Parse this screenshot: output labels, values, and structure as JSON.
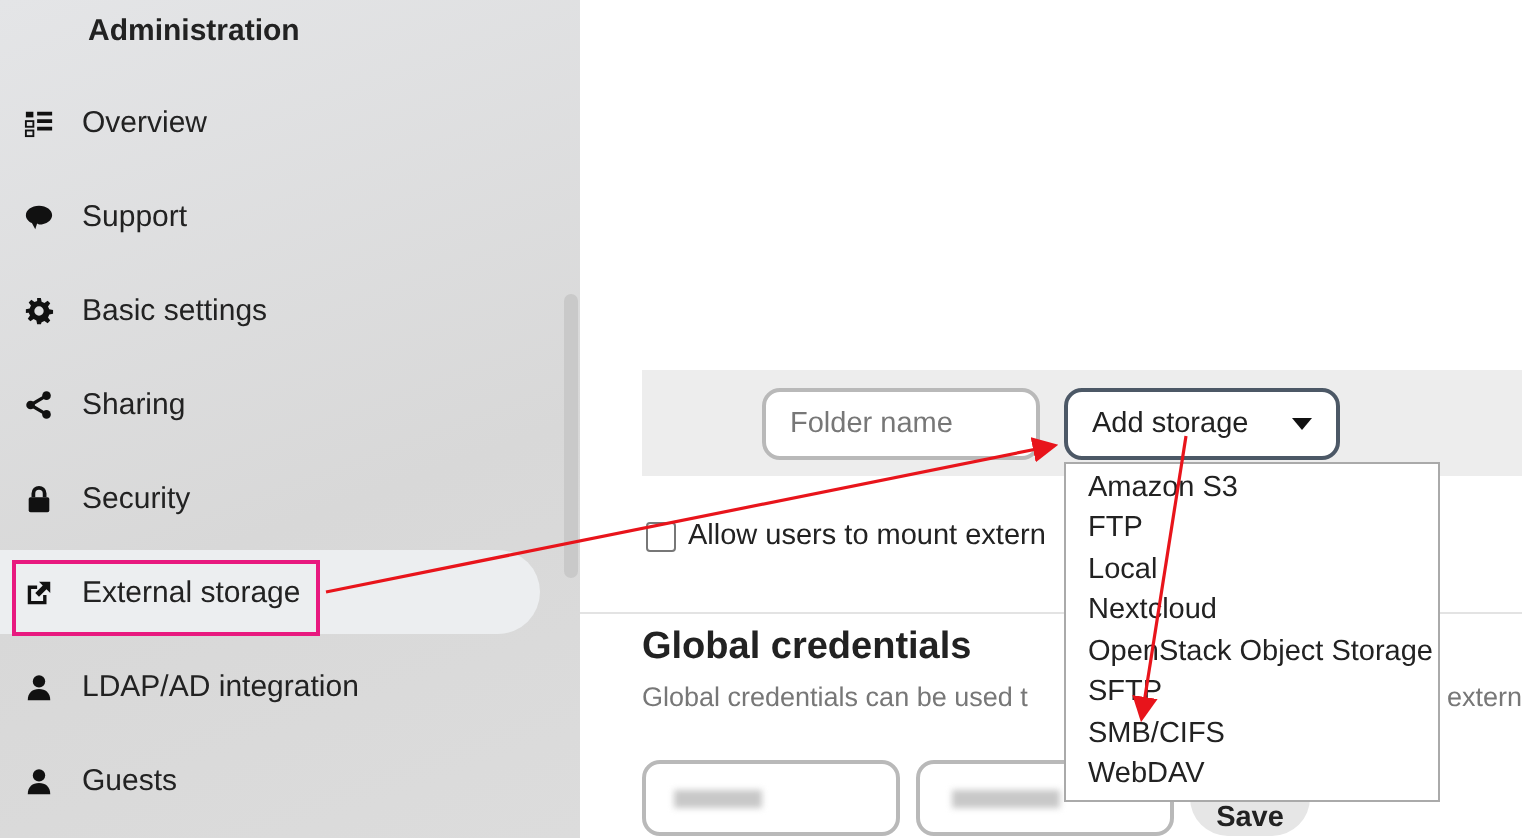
{
  "sidebar": {
    "heading": "Administration",
    "items": [
      {
        "label": "Overview",
        "selected": false
      },
      {
        "label": "Support",
        "selected": false
      },
      {
        "label": "Basic settings",
        "selected": false
      },
      {
        "label": "Sharing",
        "selected": false
      },
      {
        "label": "Security",
        "selected": false
      },
      {
        "label": "External storage",
        "selected": true
      },
      {
        "label": "LDAP/AD integration",
        "selected": false
      },
      {
        "label": "Guests",
        "selected": false
      }
    ]
  },
  "storage_bar": {
    "folder_placeholder": "Folder name",
    "add_storage": "Add storage",
    "dropdown_open": true,
    "options": [
      "Amazon S3",
      "FTP",
      "Local",
      "Nextcloud",
      "OpenStack Object Storage",
      "SFTP",
      "SMB/CIFS",
      "WebDAV"
    ]
  },
  "allow_mount": {
    "label": "Allow users to mount extern",
    "checked": false
  },
  "global_credentials": {
    "title": "Global credentials",
    "description_start": "Global credentials can be used t",
    "description_end": "extern",
    "save": "Save"
  },
  "annotations": {
    "highlight_selected": true
  }
}
